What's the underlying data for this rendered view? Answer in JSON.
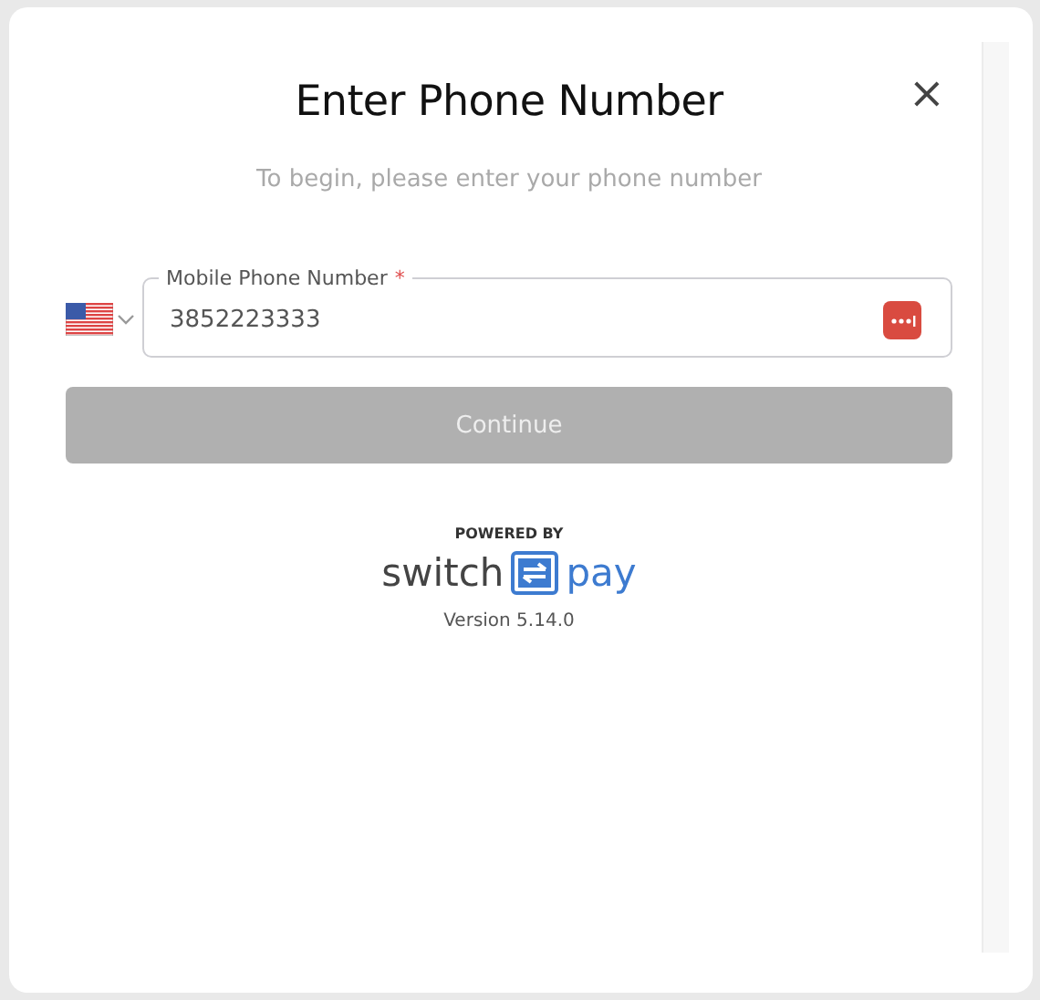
{
  "dialog": {
    "title": "Enter Phone Number",
    "close": "×",
    "subtitle": "To begin, please enter your phone number"
  },
  "phone_field": {
    "label": "Mobile Phone Number",
    "required_mark": "*",
    "value": "3852223333"
  },
  "continue_button": {
    "label": "Continue",
    "disabled": true
  },
  "footer": {
    "powered_by": "POWERED BY",
    "logo_left": "switch",
    "logo_right": "pay",
    "version": "Version 5.14.0"
  }
}
